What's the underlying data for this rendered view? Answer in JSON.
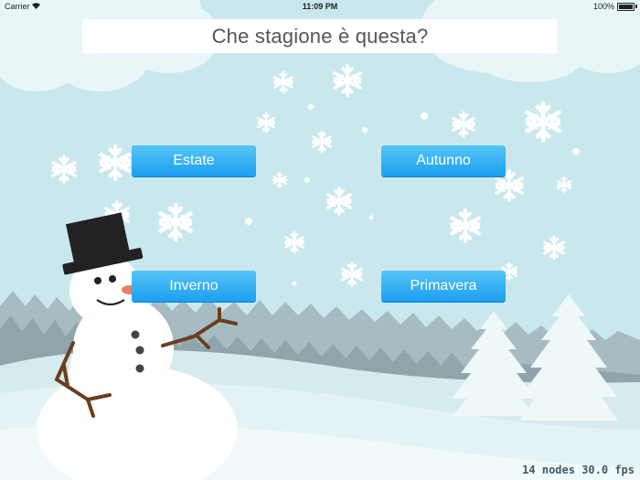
{
  "status_bar": {
    "carrier": "Carrier",
    "time": "11:09 PM",
    "battery": "100%"
  },
  "game": {
    "question": "Che stagione è questa?",
    "answers": [
      "Estate",
      "Autunno",
      "Inverno",
      "Primavera"
    ]
  },
  "debug": {
    "nodes": "14 nodes",
    "fps": "30.0 fps"
  },
  "colors": {
    "sky": "#c9e8ee",
    "snow": "#ffffff",
    "button": "#1c9ff0",
    "hills": "#9fb6bc"
  },
  "icons": [
    "wifi-icon",
    "battery-icon",
    "snowflake-icon",
    "snowman",
    "pine-tree"
  ]
}
